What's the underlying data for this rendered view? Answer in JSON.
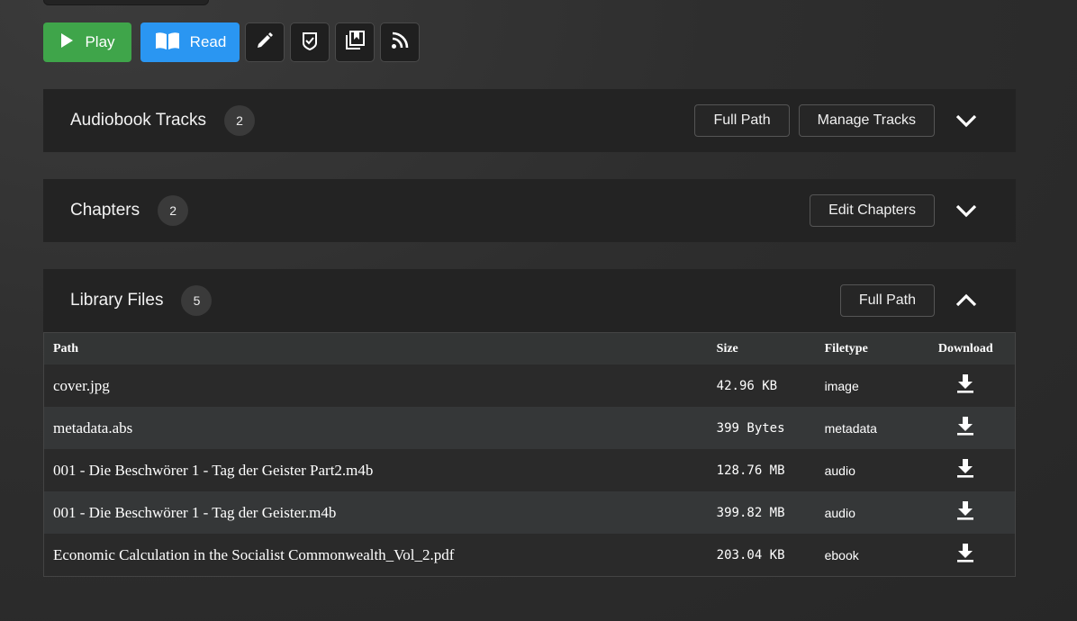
{
  "toolbar": {
    "play_label": "Play",
    "read_label": "Read",
    "icons": [
      "pencil-icon",
      "badge-check-icon",
      "collection-add-icon",
      "rss-icon"
    ]
  },
  "panels": {
    "tracks": {
      "title": "Audiobook Tracks",
      "count": "2",
      "full_path_label": "Full Path",
      "manage_label": "Manage Tracks",
      "expanded": false
    },
    "chapters": {
      "title": "Chapters",
      "count": "2",
      "edit_label": "Edit Chapters",
      "expanded": false
    },
    "files": {
      "title": "Library Files",
      "count": "5",
      "full_path_label": "Full Path",
      "expanded": true
    }
  },
  "table": {
    "headers": [
      "Path",
      "Size",
      "Filetype",
      "Download"
    ],
    "rows": [
      {
        "path": "cover.jpg",
        "size": "42.96 KB",
        "type": "image"
      },
      {
        "path": "metadata.abs",
        "size": "399 Bytes",
        "type": "metadata"
      },
      {
        "path": "001 - Die Beschwörer 1 - Tag der Geister Part2.m4b",
        "size": "128.76 MB",
        "type": "audio"
      },
      {
        "path": "001 - Die Beschwörer 1 - Tag der Geister.m4b",
        "size": "399.82 MB",
        "type": "audio"
      },
      {
        "path": "Economic Calculation in the Socialist Commonwealth_Vol_2.pdf",
        "size": "203.04 KB",
        "type": "ebook"
      }
    ]
  },
  "colors": {
    "play": "#3fa54a",
    "read": "#2a96f2",
    "panel": "#232323",
    "row_alt": "#353738"
  }
}
